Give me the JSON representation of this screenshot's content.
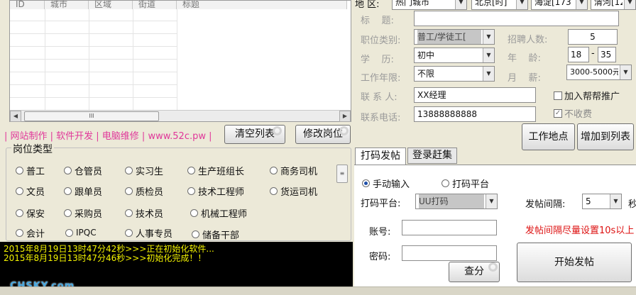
{
  "grid": {
    "columns": [
      "ID",
      "城市",
      "区域",
      "街道",
      "标题"
    ],
    "scroll_thumb": "III"
  },
  "promo": "| 网站制作 | 软件开发 | 电脑维修 | www.52c.pw |",
  "buttons": {
    "clear_list": "清空列表",
    "edit_post": "修改岗位",
    "work_location": "工作地点",
    "add_to_list": "增加到列表",
    "query_points": "查分",
    "start_posting": "开始发帖"
  },
  "job_types": {
    "title": "岗位类型",
    "items": [
      {
        "label": "普工",
        "selected": false
      },
      {
        "label": "仓管员",
        "selected": false
      },
      {
        "label": "实习生",
        "selected": false
      },
      {
        "label": "生产班组长",
        "selected": false
      },
      {
        "label": "商务司机",
        "selected": false
      },
      {
        "label": "文员",
        "selected": false
      },
      {
        "label": "跟单员",
        "selected": false
      },
      {
        "label": "质检员",
        "selected": false
      },
      {
        "label": "技术工程师",
        "selected": false
      },
      {
        "label": "货运司机",
        "selected": false
      },
      {
        "label": "保安",
        "selected": false
      },
      {
        "label": "采购员",
        "selected": false
      },
      {
        "label": "技术员",
        "selected": false
      },
      {
        "label": "机械工程师",
        "selected": false
      },
      {
        "label": "会计",
        "selected": false
      },
      {
        "label": "IPQC",
        "selected": false
      },
      {
        "label": "人事专员",
        "selected": false
      },
      {
        "label": "储备干部",
        "selected": false
      }
    ]
  },
  "log": {
    "lines": [
      "2015年8月19日13时47分42秒>>>正在初始化软件...",
      "2015年8月19日13时47分46秒>>>初始化完成！！"
    ]
  },
  "form": {
    "region_label": "地 区:",
    "region_values": [
      "热门城市",
      "北京[时]",
      "海淀[173",
      "清河[12"
    ],
    "title_label": "标    题:",
    "title_value": "",
    "category_label": "职位类别:",
    "category_value": "普工/学徒工[",
    "recruit_label": "招聘人数:",
    "recruit_value": "5",
    "education_label": "学    历:",
    "education_value": "初中",
    "age_label": "年    龄:",
    "age_min": "18",
    "age_sep": "-",
    "age_max": "35",
    "experience_label": "工作年限:",
    "experience_value": "不限",
    "salary_label": "月    薪:",
    "salary_value": "3000-5000元",
    "contact_label": "联 系 人:",
    "contact_value": "XX经理",
    "phone_label": "联系电话:",
    "phone_value": "13888888888",
    "join_help": "加入帮帮推广",
    "no_fee": "不收费",
    "no_fee_mark": "✓"
  },
  "tabs": [
    {
      "label": "打码发帖",
      "active": true
    },
    {
      "label": "登录赶集",
      "active": false
    }
  ],
  "posting": {
    "manual_input": "手动输入",
    "captcha_platform_radio": "打码平台",
    "platform_label": "打码平台:",
    "platform_value": "UU打码",
    "interval_label": "发帖间隔:",
    "interval_value": "5",
    "interval_unit": "秒",
    "account_label": "账号:",
    "account_value": "",
    "password_label": "密码:",
    "password_value": "",
    "warning": "发帖间隔尽量设置10s以上"
  },
  "watermark": "CHSKY.com",
  "colors": {
    "promo": "#e0389a",
    "warning": "#dd1111",
    "log_text": "#f5f500",
    "log_bg": "#000000"
  }
}
